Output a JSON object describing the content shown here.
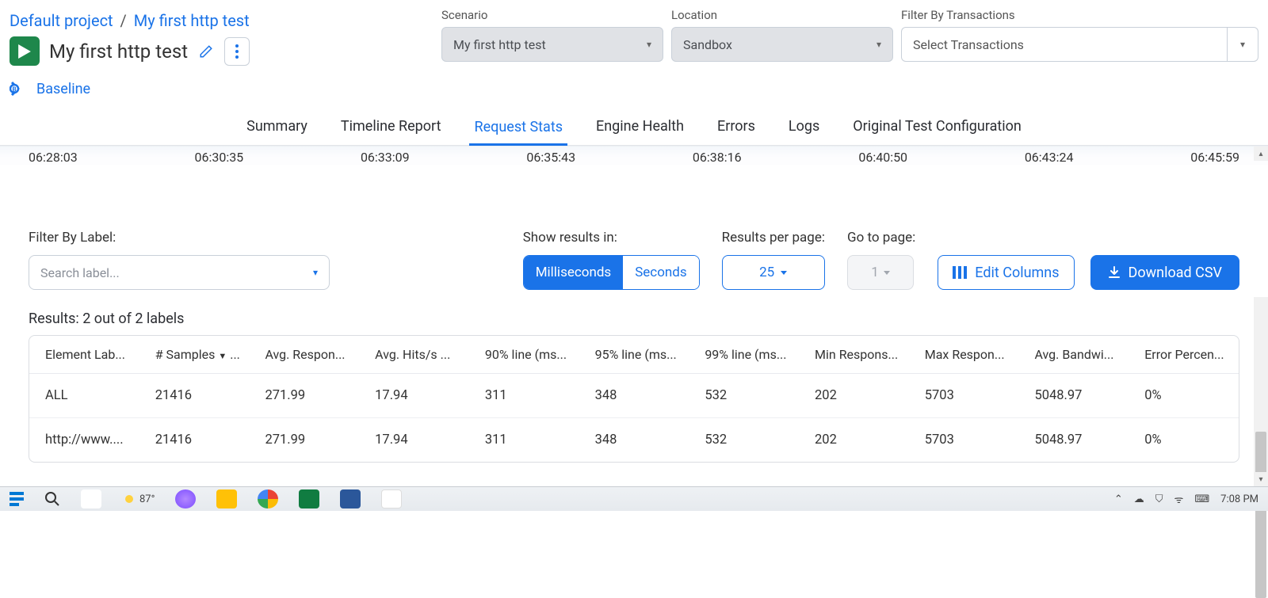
{
  "breadcrumb": {
    "project": "Default project",
    "test": "My first http test"
  },
  "title": "My first http test",
  "baseline_label": "Baseline",
  "controls": {
    "scenario_label": "Scenario",
    "scenario_value": "My first http test",
    "location_label": "Location",
    "location_value": "Sandbox",
    "filter_label": "Filter By Transactions",
    "filter_value": "Select Transactions"
  },
  "tabs": [
    "Summary",
    "Timeline Report",
    "Request Stats",
    "Engine Health",
    "Errors",
    "Logs",
    "Original Test Configuration"
  ],
  "active_tab": "Request Stats",
  "timeline": [
    "06:28:03",
    "06:30:35",
    "06:33:09",
    "06:35:43",
    "06:38:16",
    "06:40:50",
    "06:43:24",
    "06:45:59"
  ],
  "filter_by_label": {
    "label": "Filter By Label:",
    "placeholder": "Search label..."
  },
  "show_results": {
    "label": "Show results in:",
    "opt_ms": "Milliseconds",
    "opt_s": "Seconds",
    "active": "Milliseconds"
  },
  "results_per_page": {
    "label": "Results per page:",
    "value": "25"
  },
  "go_to_page": {
    "label": "Go to page:",
    "value": "1"
  },
  "edit_columns": "Edit Columns",
  "download_csv": "Download CSV",
  "results_header": "Results: 2 out of 2 labels",
  "columns": [
    "Element Lab...",
    "# Samples",
    "Avg. Respon...",
    "Avg. Hits/s ...",
    "90% line (ms...",
    "95% line (ms...",
    "99% line (ms...",
    "Min Respons...",
    "Max Respon...",
    "Avg. Bandwi...",
    "Error Percen..."
  ],
  "rows": [
    {
      "label": "ALL",
      "samples": "21416",
      "avg_resp": "271.99",
      "hits": "17.94",
      "p90": "311",
      "p95": "348",
      "p99": "532",
      "min": "202",
      "max": "5703",
      "bw": "5048.97",
      "err": "0%"
    },
    {
      "label": "http://www....",
      "samples": "21416",
      "avg_resp": "271.99",
      "hits": "17.94",
      "p90": "311",
      "p95": "348",
      "p99": "532",
      "min": "202",
      "max": "5703",
      "bw": "5048.97",
      "err": "0%"
    }
  ],
  "taskbar": {
    "temp": "87°",
    "time": "7:08 PM"
  }
}
